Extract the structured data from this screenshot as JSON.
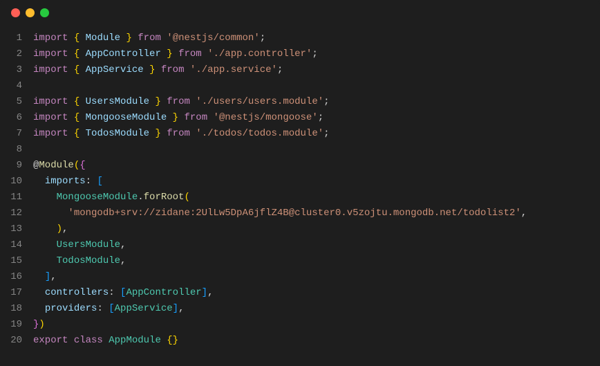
{
  "window": {
    "traffic_lights": [
      "close",
      "minimize",
      "zoom"
    ]
  },
  "colors": {
    "bg": "#1e1e1e",
    "gutter": "#858585",
    "keyword": "#c586c0",
    "type": "#4ec9b0",
    "string": "#ce9178",
    "ident": "#9cdcfe",
    "func": "#dcdcaa",
    "brace1": "#ffd700",
    "brace2": "#da70d6",
    "brace3": "#179fff"
  },
  "gutter": [
    "1",
    "2",
    "3",
    "4",
    "5",
    "6",
    "7",
    "8",
    "9",
    "10",
    "11",
    "12",
    "13",
    "14",
    "15",
    "16",
    "17",
    "18",
    "19",
    "20"
  ],
  "code": {
    "lines": [
      [
        {
          "c": "tok-keyword",
          "t": "import"
        },
        {
          "c": "tok-punct",
          "t": " "
        },
        {
          "c": "tok-brace",
          "t": "{"
        },
        {
          "c": "tok-punct",
          "t": " "
        },
        {
          "c": "tok-ident",
          "t": "Module"
        },
        {
          "c": "tok-punct",
          "t": " "
        },
        {
          "c": "tok-brace",
          "t": "}"
        },
        {
          "c": "tok-punct",
          "t": " "
        },
        {
          "c": "tok-keyword",
          "t": "from"
        },
        {
          "c": "tok-punct",
          "t": " "
        },
        {
          "c": "tok-string",
          "t": "'@nestjs/common'"
        },
        {
          "c": "tok-punct",
          "t": ";"
        }
      ],
      [
        {
          "c": "tok-keyword",
          "t": "import"
        },
        {
          "c": "tok-punct",
          "t": " "
        },
        {
          "c": "tok-brace",
          "t": "{"
        },
        {
          "c": "tok-punct",
          "t": " "
        },
        {
          "c": "tok-ident",
          "t": "AppController"
        },
        {
          "c": "tok-punct",
          "t": " "
        },
        {
          "c": "tok-brace",
          "t": "}"
        },
        {
          "c": "tok-punct",
          "t": " "
        },
        {
          "c": "tok-keyword",
          "t": "from"
        },
        {
          "c": "tok-punct",
          "t": " "
        },
        {
          "c": "tok-string",
          "t": "'./app.controller'"
        },
        {
          "c": "tok-punct",
          "t": ";"
        }
      ],
      [
        {
          "c": "tok-keyword",
          "t": "import"
        },
        {
          "c": "tok-punct",
          "t": " "
        },
        {
          "c": "tok-brace",
          "t": "{"
        },
        {
          "c": "tok-punct",
          "t": " "
        },
        {
          "c": "tok-ident",
          "t": "AppService"
        },
        {
          "c": "tok-punct",
          "t": " "
        },
        {
          "c": "tok-brace",
          "t": "}"
        },
        {
          "c": "tok-punct",
          "t": " "
        },
        {
          "c": "tok-keyword",
          "t": "from"
        },
        {
          "c": "tok-punct",
          "t": " "
        },
        {
          "c": "tok-string",
          "t": "'./app.service'"
        },
        {
          "c": "tok-punct",
          "t": ";"
        }
      ],
      [],
      [
        {
          "c": "tok-keyword",
          "t": "import"
        },
        {
          "c": "tok-punct",
          "t": " "
        },
        {
          "c": "tok-brace",
          "t": "{"
        },
        {
          "c": "tok-punct",
          "t": " "
        },
        {
          "c": "tok-ident",
          "t": "UsersModule"
        },
        {
          "c": "tok-punct",
          "t": " "
        },
        {
          "c": "tok-brace",
          "t": "}"
        },
        {
          "c": "tok-punct",
          "t": " "
        },
        {
          "c": "tok-keyword",
          "t": "from"
        },
        {
          "c": "tok-punct",
          "t": " "
        },
        {
          "c": "tok-string",
          "t": "'./users/users.module'"
        },
        {
          "c": "tok-punct",
          "t": ";"
        }
      ],
      [
        {
          "c": "tok-keyword",
          "t": "import"
        },
        {
          "c": "tok-punct",
          "t": " "
        },
        {
          "c": "tok-brace",
          "t": "{"
        },
        {
          "c": "tok-punct",
          "t": " "
        },
        {
          "c": "tok-ident",
          "t": "MongooseModule"
        },
        {
          "c": "tok-punct",
          "t": " "
        },
        {
          "c": "tok-brace",
          "t": "}"
        },
        {
          "c": "tok-punct",
          "t": " "
        },
        {
          "c": "tok-keyword",
          "t": "from"
        },
        {
          "c": "tok-punct",
          "t": " "
        },
        {
          "c": "tok-string",
          "t": "'@nestjs/mongoose'"
        },
        {
          "c": "tok-punct",
          "t": ";"
        }
      ],
      [
        {
          "c": "tok-keyword",
          "t": "import"
        },
        {
          "c": "tok-punct",
          "t": " "
        },
        {
          "c": "tok-brace",
          "t": "{"
        },
        {
          "c": "tok-punct",
          "t": " "
        },
        {
          "c": "tok-ident",
          "t": "TodosModule"
        },
        {
          "c": "tok-punct",
          "t": " "
        },
        {
          "c": "tok-brace",
          "t": "}"
        },
        {
          "c": "tok-punct",
          "t": " "
        },
        {
          "c": "tok-keyword",
          "t": "from"
        },
        {
          "c": "tok-punct",
          "t": " "
        },
        {
          "c": "tok-string",
          "t": "'./todos/todos.module'"
        },
        {
          "c": "tok-punct",
          "t": ";"
        }
      ],
      [],
      [
        {
          "c": "tok-punct",
          "t": "@"
        },
        {
          "c": "tok-at",
          "t": "Module"
        },
        {
          "c": "tok-brace",
          "t": "("
        },
        {
          "c": "tok-brace2",
          "t": "{"
        }
      ],
      [
        {
          "c": "tok-punct",
          "t": "  "
        },
        {
          "c": "tok-ident",
          "t": "imports"
        },
        {
          "c": "tok-punct",
          "t": ": "
        },
        {
          "c": "tok-brace3",
          "t": "["
        }
      ],
      [
        {
          "c": "tok-punct",
          "t": "    "
        },
        {
          "c": "tok-type",
          "t": "MongooseModule"
        },
        {
          "c": "tok-punct",
          "t": "."
        },
        {
          "c": "tok-func",
          "t": "forRoot"
        },
        {
          "c": "tok-brace",
          "t": "("
        }
      ],
      [
        {
          "c": "tok-punct",
          "t": "      "
        },
        {
          "c": "tok-string",
          "t": "'mongodb+srv://zidane:2UlLw5DpA6jflZ4B@cluster0.v5zojtu.mongodb.net/todolist2'"
        },
        {
          "c": "tok-punct",
          "t": ","
        }
      ],
      [
        {
          "c": "tok-punct",
          "t": "    "
        },
        {
          "c": "tok-brace",
          "t": ")"
        },
        {
          "c": "tok-punct",
          "t": ","
        }
      ],
      [
        {
          "c": "tok-punct",
          "t": "    "
        },
        {
          "c": "tok-type",
          "t": "UsersModule"
        },
        {
          "c": "tok-punct",
          "t": ","
        }
      ],
      [
        {
          "c": "tok-punct",
          "t": "    "
        },
        {
          "c": "tok-type",
          "t": "TodosModule"
        },
        {
          "c": "tok-punct",
          "t": ","
        }
      ],
      [
        {
          "c": "tok-punct",
          "t": "  "
        },
        {
          "c": "tok-brace3",
          "t": "]"
        },
        {
          "c": "tok-punct",
          "t": ","
        }
      ],
      [
        {
          "c": "tok-punct",
          "t": "  "
        },
        {
          "c": "tok-ident",
          "t": "controllers"
        },
        {
          "c": "tok-punct",
          "t": ": "
        },
        {
          "c": "tok-brace3",
          "t": "["
        },
        {
          "c": "tok-type",
          "t": "AppController"
        },
        {
          "c": "tok-brace3",
          "t": "]"
        },
        {
          "c": "tok-punct",
          "t": ","
        }
      ],
      [
        {
          "c": "tok-punct",
          "t": "  "
        },
        {
          "c": "tok-ident",
          "t": "providers"
        },
        {
          "c": "tok-punct",
          "t": ": "
        },
        {
          "c": "tok-brace3",
          "t": "["
        },
        {
          "c": "tok-type",
          "t": "AppService"
        },
        {
          "c": "tok-brace3",
          "t": "]"
        },
        {
          "c": "tok-punct",
          "t": ","
        }
      ],
      [
        {
          "c": "tok-brace2",
          "t": "}"
        },
        {
          "c": "tok-brace",
          "t": ")"
        }
      ],
      [
        {
          "c": "tok-keyword",
          "t": "export"
        },
        {
          "c": "tok-punct",
          "t": " "
        },
        {
          "c": "tok-keyword",
          "t": "class"
        },
        {
          "c": "tok-punct",
          "t": " "
        },
        {
          "c": "tok-type",
          "t": "AppModule"
        },
        {
          "c": "tok-punct",
          "t": " "
        },
        {
          "c": "tok-brace",
          "t": "{}"
        }
      ]
    ]
  }
}
